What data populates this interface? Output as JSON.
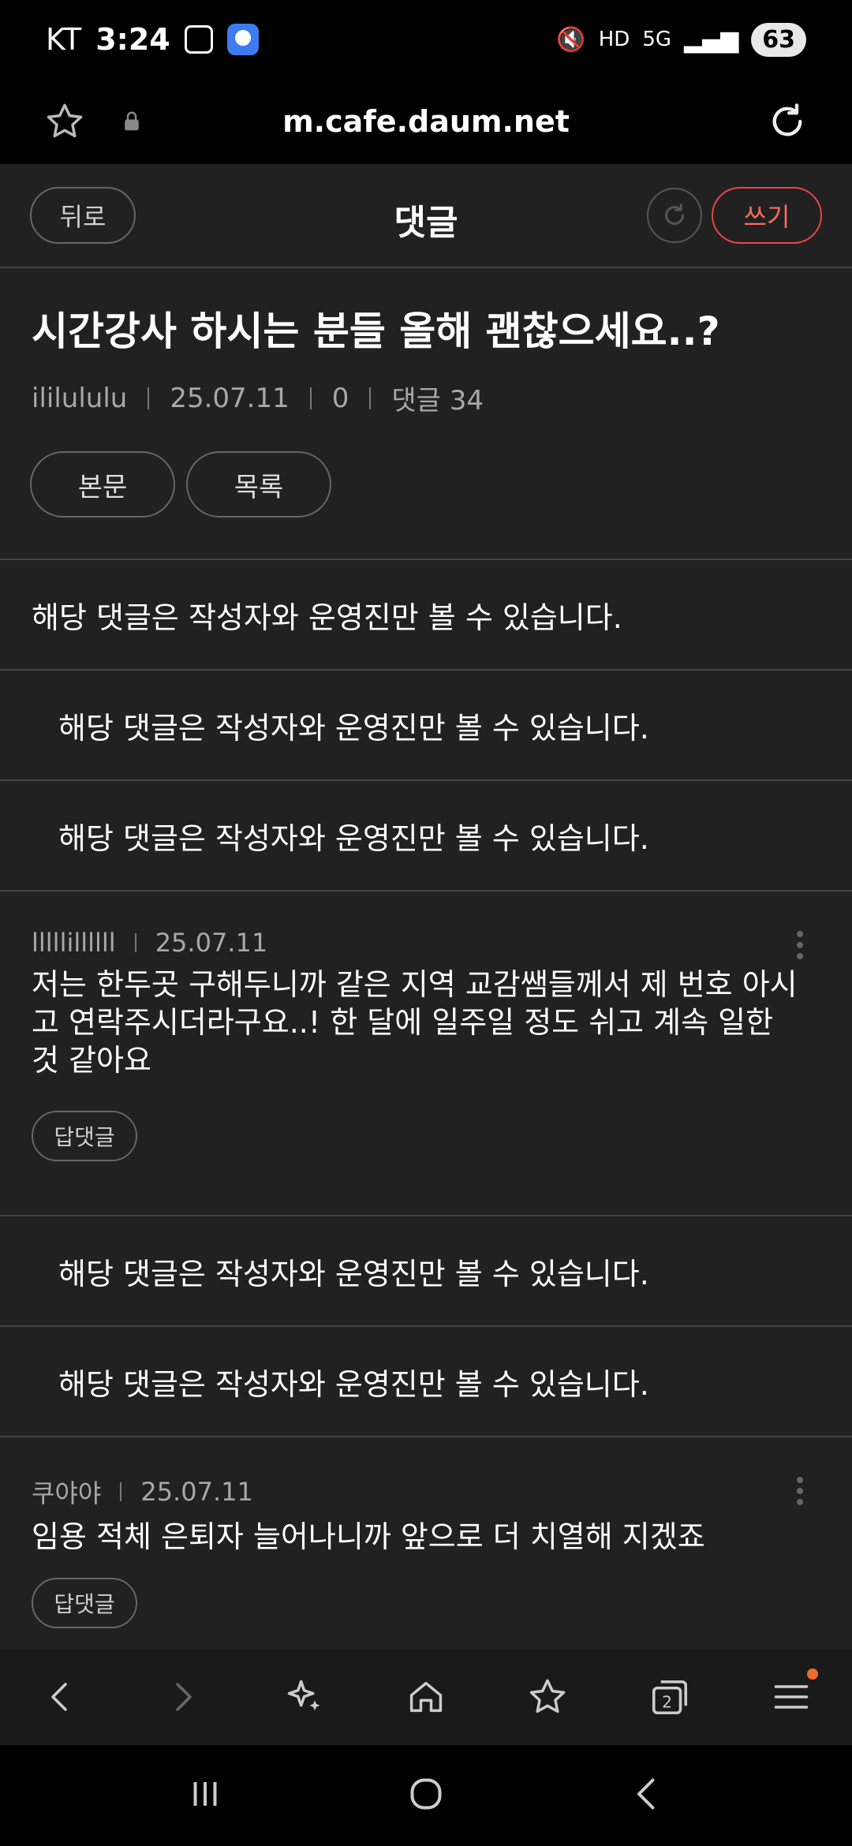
{
  "status_bar": {
    "carrier": "KT",
    "time": "3:24",
    "network": "5G",
    "hd": "HD",
    "battery": "63"
  },
  "browser": {
    "url": "m.cafe.daum.net"
  },
  "top_nav": {
    "back_label": "뒤로",
    "title": "댓글",
    "write_label": "쓰기"
  },
  "post": {
    "title": "시간강사 하시는 분들 올해 괜찮으세요..?",
    "author": "ililululu",
    "date": "25.07.11",
    "views": "0",
    "comment_count": "댓글 34",
    "body_button": "본문",
    "list_button": "목록"
  },
  "comments": {
    "hidden_text": "해당 댓글은 작성자와 운영진만 볼 수 있습니다.",
    "c1": {
      "author": "lllllillllll",
      "date": "25.07.11",
      "text": "저는 한두곳 구해두니까 같은 지역 교감쌤들께서 제 번호 아시고 연락주시더라구요..! 한 달에 일주일 정도 쉬고 계속 일한 것 같아요",
      "reply_label": "답댓글"
    },
    "c2": {
      "author": "쿠야야",
      "date": "25.07.11",
      "text": "임용 적체 은퇴자 늘어나니까 앞으로 더 치열해 지겠죠",
      "reply_label": "답댓글"
    }
  },
  "bottom_bar": {
    "tabs_count": "2"
  },
  "colors": {
    "background": "#212121",
    "accent": "#e8473f",
    "divider": "#444444"
  }
}
